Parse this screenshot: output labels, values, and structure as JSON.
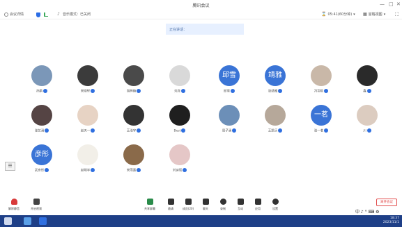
{
  "window": {
    "title": "腾讯会议",
    "minimize": "—",
    "maximize": "□",
    "close": "✕"
  },
  "infobar": {
    "meeting_details": "会议详情",
    "music_mode": "音乐模式：已关闭",
    "participant_count": "05:41(60分钟)",
    "view_mode": "宫格视图"
  },
  "speaking_label": "正在讲话：",
  "participants": [
    {
      "name": "孙鹏",
      "avatar_text": ""
    },
    {
      "name": "宋刚轩",
      "avatar_text": ""
    },
    {
      "name": "胡梓楠",
      "avatar_text": ""
    },
    {
      "name": "刘尧",
      "avatar_text": ""
    },
    {
      "name": "邱雪",
      "avatar_text": "邱雪"
    },
    {
      "name": "张靖雅",
      "avatar_text": "靖雅"
    },
    {
      "name": "冯羽晗",
      "avatar_text": ""
    },
    {
      "name": "鑫",
      "avatar_text": ""
    },
    {
      "name": "张艺涵",
      "avatar_text": ""
    },
    {
      "name": "赵天一",
      "avatar_text": ""
    },
    {
      "name": "王浩宇",
      "avatar_text": ""
    },
    {
      "name": "Best",
      "avatar_text": ""
    },
    {
      "name": "周子涵",
      "avatar_text": ""
    },
    {
      "name": "王凯乐",
      "avatar_text": ""
    },
    {
      "name": "张一茗",
      "avatar_text": "一茗"
    },
    {
      "name": "川",
      "avatar_text": ""
    },
    {
      "name": "武彦彤",
      "avatar_text": "彦彤"
    },
    {
      "name": "赵明宇",
      "avatar_text": ""
    },
    {
      "name": "宋雨嘉",
      "avatar_text": ""
    },
    {
      "name": "刘诗瑶",
      "avatar_text": ""
    }
  ],
  "toolbar": {
    "left": [
      {
        "label": "解除静音"
      },
      {
        "label": "开启视频"
      }
    ],
    "center": [
      {
        "label": "共享屏幕"
      },
      {
        "label": "邀请"
      },
      {
        "label": "成员(20)"
      },
      {
        "label": "聊天"
      },
      {
        "label": "录制"
      },
      {
        "label": "互动"
      },
      {
        "label": "应用"
      },
      {
        "label": "设置"
      }
    ],
    "end_button": "离开会议"
  },
  "ime": "中 ♪ ° ⌨ ⚙",
  "taskbar": {
    "time": "18:37",
    "date": "2023/11/1"
  },
  "colors": {
    "accent": "#2f6fe0",
    "taskbar": "#1e3f87",
    "end": "#e14b4b"
  }
}
